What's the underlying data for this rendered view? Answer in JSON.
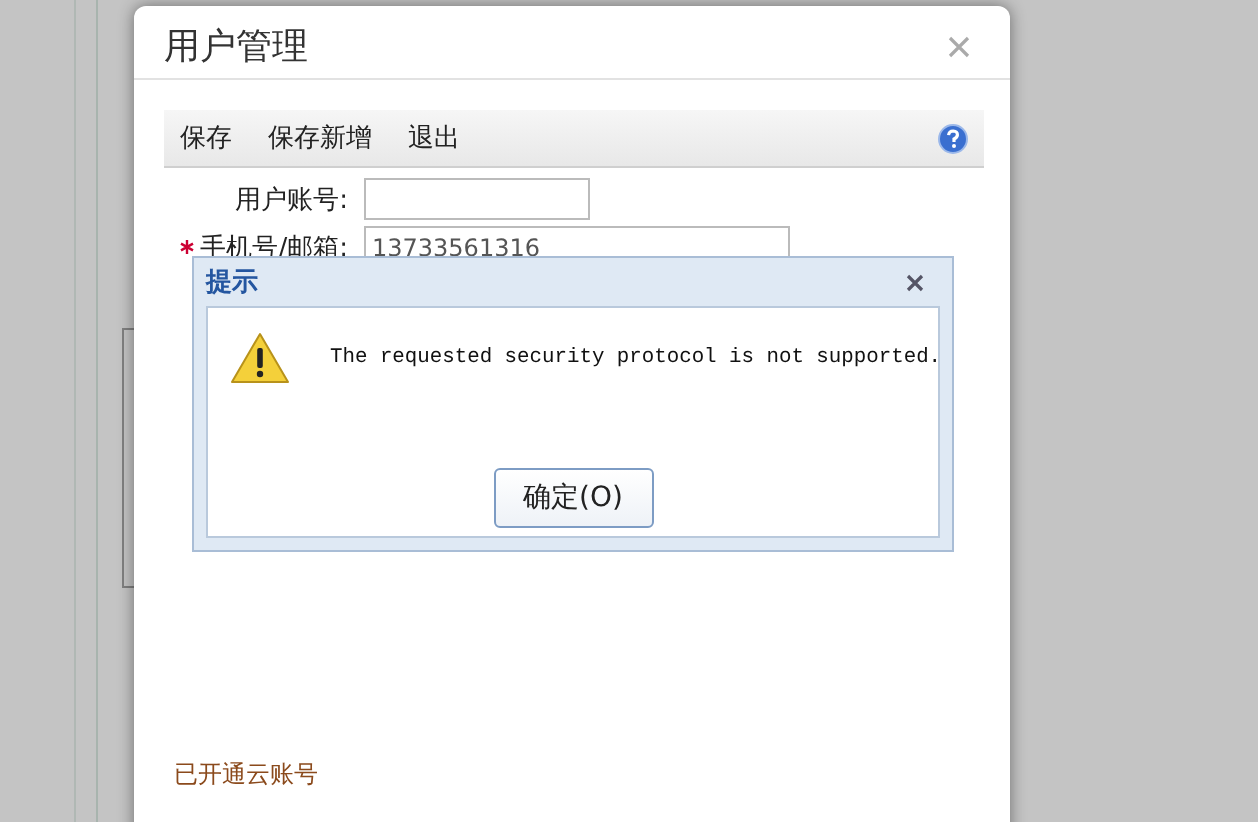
{
  "window": {
    "title": "用户管理"
  },
  "toolbar": {
    "buttons": [
      "保存",
      "保存新增",
      "退出"
    ]
  },
  "form": {
    "fields": [
      {
        "label": "用户账号:",
        "required": false
      },
      {
        "label": "手机号/邮箱:",
        "required": true,
        "value": "13733561316"
      }
    ]
  },
  "footer": {
    "text": "已开通云账号"
  },
  "alert": {
    "title": "提示",
    "message": "The requested security protocol is not supported.",
    "button": "确定(O)"
  }
}
